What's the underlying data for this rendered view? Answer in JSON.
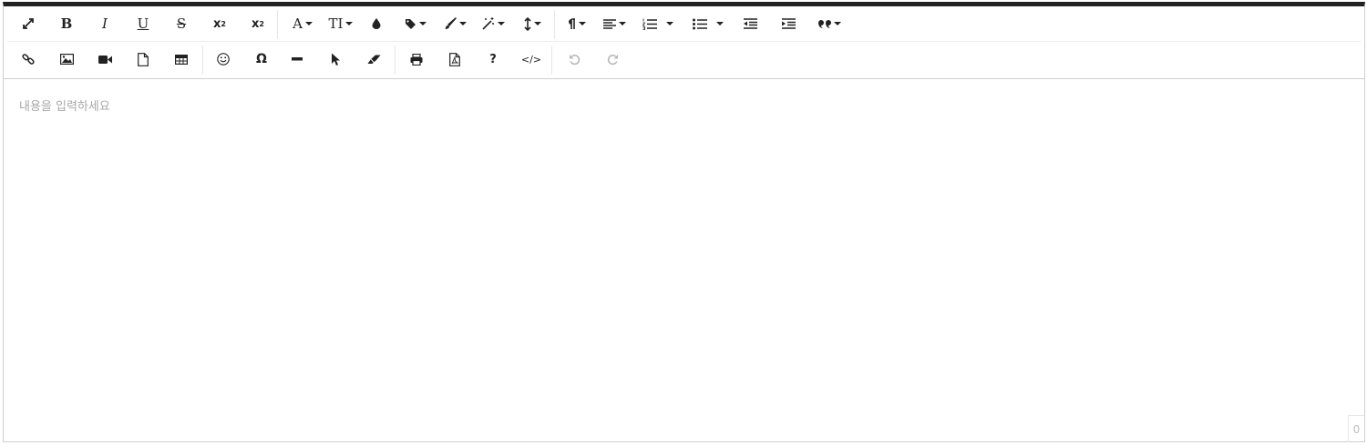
{
  "toolbar": {
    "bold_label": "B",
    "italic_label": "I",
    "underline_label": "U",
    "strikethrough_label": "S",
    "subscript_label": "x",
    "subscript_mark": "2",
    "superscript_label": "x",
    "superscript_mark": "2",
    "font_family_label": "A",
    "font_size_label": "TI",
    "special_char_label": "Ω",
    "help_label": "?",
    "code_label": "</>",
    "icons": {
      "fullscreen": "expand-icon",
      "color": "drop-icon",
      "tag": "tag-icon",
      "brush": "brush-icon",
      "magic": "magic-wand-icon",
      "line_height": "line-height-icon",
      "paragraph": "paragraph-icon",
      "align": "align-left-icon",
      "ordered_list": "ordered-list-icon",
      "unordered_list": "unordered-list-icon",
      "outdent": "outdent-icon",
      "indent": "indent-icon",
      "quote": "quote-icon",
      "link": "link-icon",
      "image": "image-icon",
      "video": "video-icon",
      "file": "file-icon",
      "table": "table-icon",
      "emoticon": "smile-icon",
      "horizontal_rule": "minus-icon",
      "select": "cursor-icon",
      "eraser": "eraser-icon",
      "print": "print-icon",
      "pdf": "pdf-icon",
      "undo": "undo-icon",
      "redo": "redo-icon"
    }
  },
  "editor": {
    "placeholder": "내용을 입력하세요",
    "char_count": "0"
  }
}
